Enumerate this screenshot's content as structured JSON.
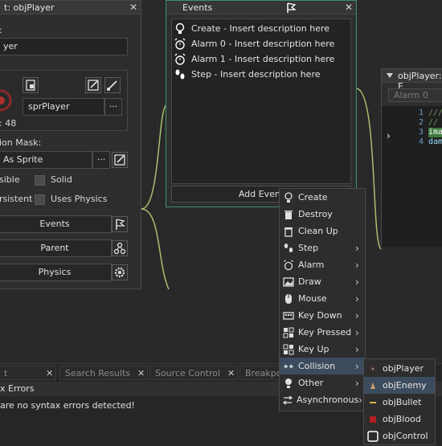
{
  "object_window": {
    "title": "t: objPlayer",
    "name_value": "yer",
    "sprite_name": "sprPlayer",
    "sprite_info": ": 48",
    "collision_mask_label": "ion Mask:",
    "collision_mask_value": "As Sprite",
    "visible_label": "sible",
    "solid_label": "Solid",
    "persistent_label": "rsistent",
    "uses_physics_label": "Uses Physics",
    "events_button": "Events",
    "parent_button": "Parent",
    "physics_button": "Physics",
    "more_label": "···"
  },
  "events_window": {
    "title": "Events",
    "events": [
      {
        "icon": "lightbulb-icon",
        "label": "Create - Insert description here"
      },
      {
        "icon": "alarm-icon",
        "label": "Alarm 0 - Insert description here"
      },
      {
        "icon": "alarm-icon",
        "label": "Alarm 1 - Insert description here"
      },
      {
        "icon": "footsteps-icon",
        "label": "Step - Insert description here"
      }
    ],
    "add_event_label": "Add Event"
  },
  "code_window": {
    "title": "objPlayer: E",
    "tab_label": "Alarm 0",
    "lines": [
      {
        "num": "1",
        "text": "///"
      },
      {
        "num": "2",
        "text": "//"
      },
      {
        "num": "3",
        "text": "ima"
      },
      {
        "num": "4",
        "text": "dam"
      }
    ]
  },
  "context_menu": {
    "items": [
      {
        "label": "Create",
        "arrow": false
      },
      {
        "label": "Destroy",
        "arrow": false
      },
      {
        "label": "Clean Up",
        "arrow": false
      },
      {
        "label": "Step",
        "arrow": true
      },
      {
        "label": "Alarm",
        "arrow": true
      },
      {
        "label": "Draw",
        "arrow": true
      },
      {
        "label": "Mouse",
        "arrow": true
      },
      {
        "label": "Key Down",
        "arrow": true
      },
      {
        "label": "Key Pressed",
        "arrow": true
      },
      {
        "label": "Key Up",
        "arrow": true
      },
      {
        "label": "Collision",
        "arrow": true
      },
      {
        "label": "Other",
        "arrow": true
      },
      {
        "label": "Asynchronous",
        "arrow": true
      }
    ],
    "selected": "Collision",
    "arrow_glyph": "›"
  },
  "collision_submenu": {
    "items": [
      {
        "label": "objPlayer",
        "color": "#8a8a8a"
      },
      {
        "label": "objEnemy",
        "color": "#c9a06a"
      },
      {
        "label": "objBullet",
        "color": "#d8b050"
      },
      {
        "label": "objBlood",
        "color": "#b02020"
      },
      {
        "label": "objControl",
        "color": "#ffffff"
      }
    ],
    "selected": "objEnemy"
  },
  "bottom_panel": {
    "tabs": [
      "t",
      "Search Results",
      "Source Control",
      "Breakpoi"
    ],
    "close_glyph": "✕",
    "header": "x Errors",
    "message": "are no syntax errors detected!"
  },
  "colors": {
    "accent_green": "#3f8f6a",
    "selection": "#3c4c5e"
  }
}
